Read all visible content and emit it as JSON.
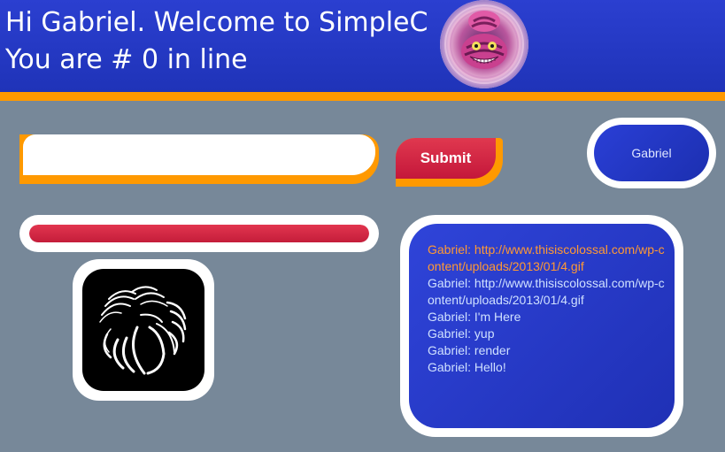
{
  "header": {
    "greeting": "Hi Gabriel. Welcome to SimpleC",
    "queue_text": "You are # 0 in line",
    "avatar_icon": "cheshire-cat-avatar-icon"
  },
  "form": {
    "message_value": "",
    "message_placeholder": "",
    "submit_label": "Submit"
  },
  "user": {
    "name": "Gabriel"
  },
  "progress": {
    "fraction": 1.0
  },
  "loader": {
    "icon": "spinning-loader-icon"
  },
  "chat": {
    "messages": [
      "Gabriel: http://www.thisiscolossal.com/wp-content/uploads/2013/01/4.gif",
      "Gabriel: http://www.thisiscolossal.com/wp-content/uploads/2013/01/4.gif",
      "Gabriel: I'm Here",
      "Gabriel: yup",
      "Gabriel: render",
      "Gabriel: Hello!"
    ]
  },
  "colors": {
    "header_blue": "#2b3fd0",
    "accent_orange": "#ff9900",
    "submit_red": "#d02743",
    "background_gray": "#778899"
  }
}
